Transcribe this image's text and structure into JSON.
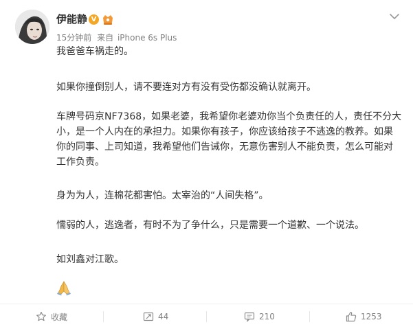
{
  "post": {
    "author": "伊能静",
    "verified_badge": "V",
    "time": "15分钟前",
    "source_prefix": "来自",
    "source": "iPhone 6s Plus",
    "paragraphs": [
      [
        "我爸爸车祸走的。"
      ],
      [
        "如果你撞倒别人，请不要连对方有没有受伤都没确认就离开。"
      ],
      [
        "车牌号码京NF7368，如果老婆，我希望你老婆劝你当个负责任的人，责任不分大",
        "小，是一个人内在的承担力。如果你有孩子，你应该给孩子不逃逸的教养。如果",
        "你的同事、上司知道，我希望他们告诫你，无意伤害别人不能负责，怎么可能对",
        "工作负责。"
      ],
      [
        "身为为人，连棉花都害怕。太宰治的“人间失格”。"
      ],
      [
        "懦弱的人，逃逸者，有时不为了争什么，只是需要一个道歉、一个说法。"
      ],
      [
        "如刘鑫对江歌。"
      ]
    ],
    "emoji": "pray-hands-emoji"
  },
  "footer": {
    "favorite_label": "收藏",
    "repost_count": "44",
    "comment_count": "210",
    "like_count": "1253"
  },
  "colors": {
    "text": "#333333",
    "meta": "#808080",
    "verified": "#f5a623",
    "emoji": "#f0b84a"
  },
  "icons": {
    "favorite": "star-icon",
    "repost": "repost-icon",
    "comment": "comment-icon",
    "like": "thumbs-up-icon",
    "menu": "chevron-down-icon"
  }
}
